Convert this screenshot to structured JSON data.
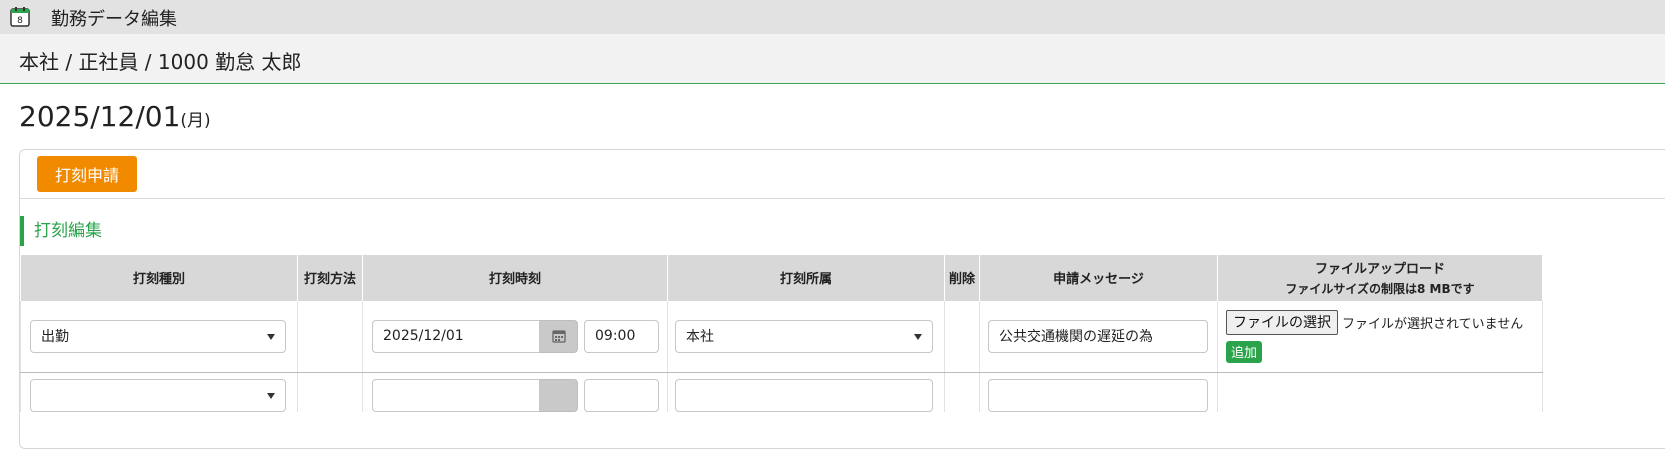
{
  "window": {
    "title": "勤務データ編集",
    "icon": "calendar-app-icon"
  },
  "breadcrumb": "本社 / 正社員 / 1000 勤怠 太郎",
  "date": {
    "value": "2025/12/01",
    "weekday": "(月)"
  },
  "actions": {
    "apply_label": "打刻申請"
  },
  "section": {
    "title": "打刻編集"
  },
  "table": {
    "headers": {
      "type": "打刻種別",
      "method": "打刻方法",
      "time": "打刻時刻",
      "affiliation": "打刻所属",
      "delete": "削除",
      "message": "申請メッセージ",
      "file_upload": "ファイルアップロード",
      "file_limit": "ファイルサイズの制限は8 MBです"
    },
    "rows": [
      {
        "type": "出勤",
        "method": "",
        "date": "2025/12/01",
        "time": "09:00",
        "affiliation": "本社",
        "message": "公共交通機関の遅延の為",
        "file_button": "ファイルの選択",
        "file_status": "ファイルが選択されていません",
        "add_label": "追加"
      },
      {
        "type": "",
        "method": "",
        "date": "",
        "time": "",
        "affiliation": "",
        "message": ""
      }
    ]
  },
  "colors": {
    "accent_green": "#2aa34a",
    "apply_orange": "#f28a00",
    "header_gray": "#d8d8d8"
  }
}
